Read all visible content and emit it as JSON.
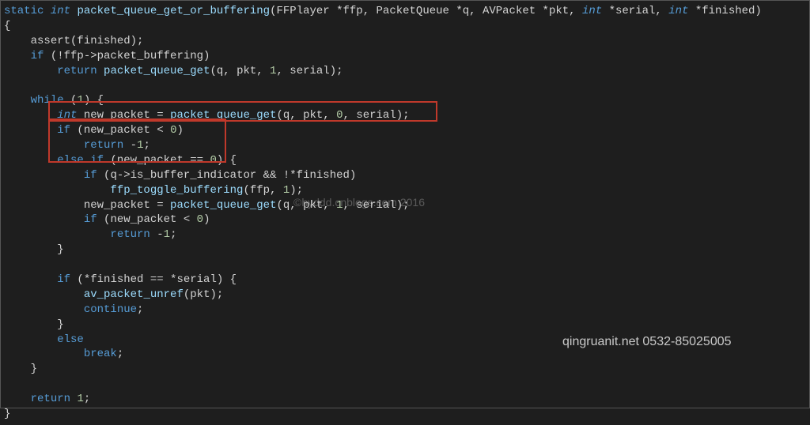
{
  "code": {
    "l1_static": "static",
    "l1_int": "int",
    "l1_fn": " packet_queue_get_or_buffering",
    "l1_sig1": "(FFPlayer *ffp, PacketQueue *q, AVPacket *pkt, ",
    "l1_int2": "int",
    "l1_sig2": " *serial, ",
    "l1_int3": "int",
    "l1_sig3": " *finished)",
    "l2": "{",
    "l3_pad": "    ",
    "l3": "assert(finished);",
    "l4_pad": "    ",
    "l4_if": "if",
    "l4_rest": " (!ffp->packet_buffering)",
    "l5_pad": "        ",
    "l5_return": "return",
    "l5_fn": " packet_queue_get",
    "l5_args1": "(q, pkt, ",
    "l5_num": "1",
    "l5_args2": ", serial);",
    "l7_pad": "    ",
    "l7_while": "while",
    "l7_rest1": " (",
    "l7_num": "1",
    "l7_rest2": ") {",
    "l8_pad": "        ",
    "l8_int": "int",
    "l8_mid": " new_packet = ",
    "l8_fn": "packet_queue_get",
    "l8_args1": "(q, pkt, ",
    "l8_num": "0",
    "l8_args2": ", serial);",
    "l9_pad": "        ",
    "l9_if": "if",
    "l9_rest1": " (new_packet < ",
    "l9_num": "0",
    "l9_rest2": ")",
    "l10_pad": "            ",
    "l10_return": "return",
    "l10_sp": " -",
    "l10_num": "1",
    "l10_semi": ";",
    "l11_pad": "        ",
    "l11_else": "else",
    "l11_sp": " ",
    "l11_if": "if",
    "l11_rest1": " (new_packet == ",
    "l11_num": "0",
    "l11_rest2": ") {",
    "l12_pad": "            ",
    "l12_if": "if",
    "l12_rest": " (q->is_buffer_indicator && !*finished)",
    "l13_pad": "                ",
    "l13_fn": "ffp_toggle_buffering",
    "l13_args1": "(ffp, ",
    "l13_num": "1",
    "l13_args2": ");",
    "l14_pad": "            ",
    "l14_lhs": "new_packet = ",
    "l14_fn": "packet_queue_get",
    "l14_args1": "(q, pkt, ",
    "l14_num": "1",
    "l14_args2": ", serial);",
    "l15_pad": "            ",
    "l15_if": "if",
    "l15_rest1": " (new_packet < ",
    "l15_num": "0",
    "l15_rest2": ")",
    "l16_pad": "                ",
    "l16_return": "return",
    "l16_sp": " -",
    "l16_num": "1",
    "l16_semi": ";",
    "l17_pad": "        ",
    "l17": "}",
    "l19_pad": "        ",
    "l19_if": "if",
    "l19_rest": " (*finished == *serial) {",
    "l20_pad": "            ",
    "l20_fn": "av_packet_unref",
    "l20_args": "(pkt);",
    "l21_pad": "            ",
    "l21_continue": "continue",
    "l21_semi": ";",
    "l22_pad": "        ",
    "l22": "}",
    "l23_pad": "        ",
    "l23_else": "else",
    "l24_pad": "            ",
    "l24_break": "break",
    "l24_semi": ";",
    "l25_pad": "    ",
    "l25": "}",
    "l27_pad": "    ",
    "l27_return": "return",
    "l27_sp": " ",
    "l27_num": "1",
    "l27_semi": ";",
    "l28": "}"
  },
  "watermarks": {
    "center": "©hyddd.cnblogs.com 2016",
    "bottom": "qingruanit.net 0532-85025005"
  }
}
